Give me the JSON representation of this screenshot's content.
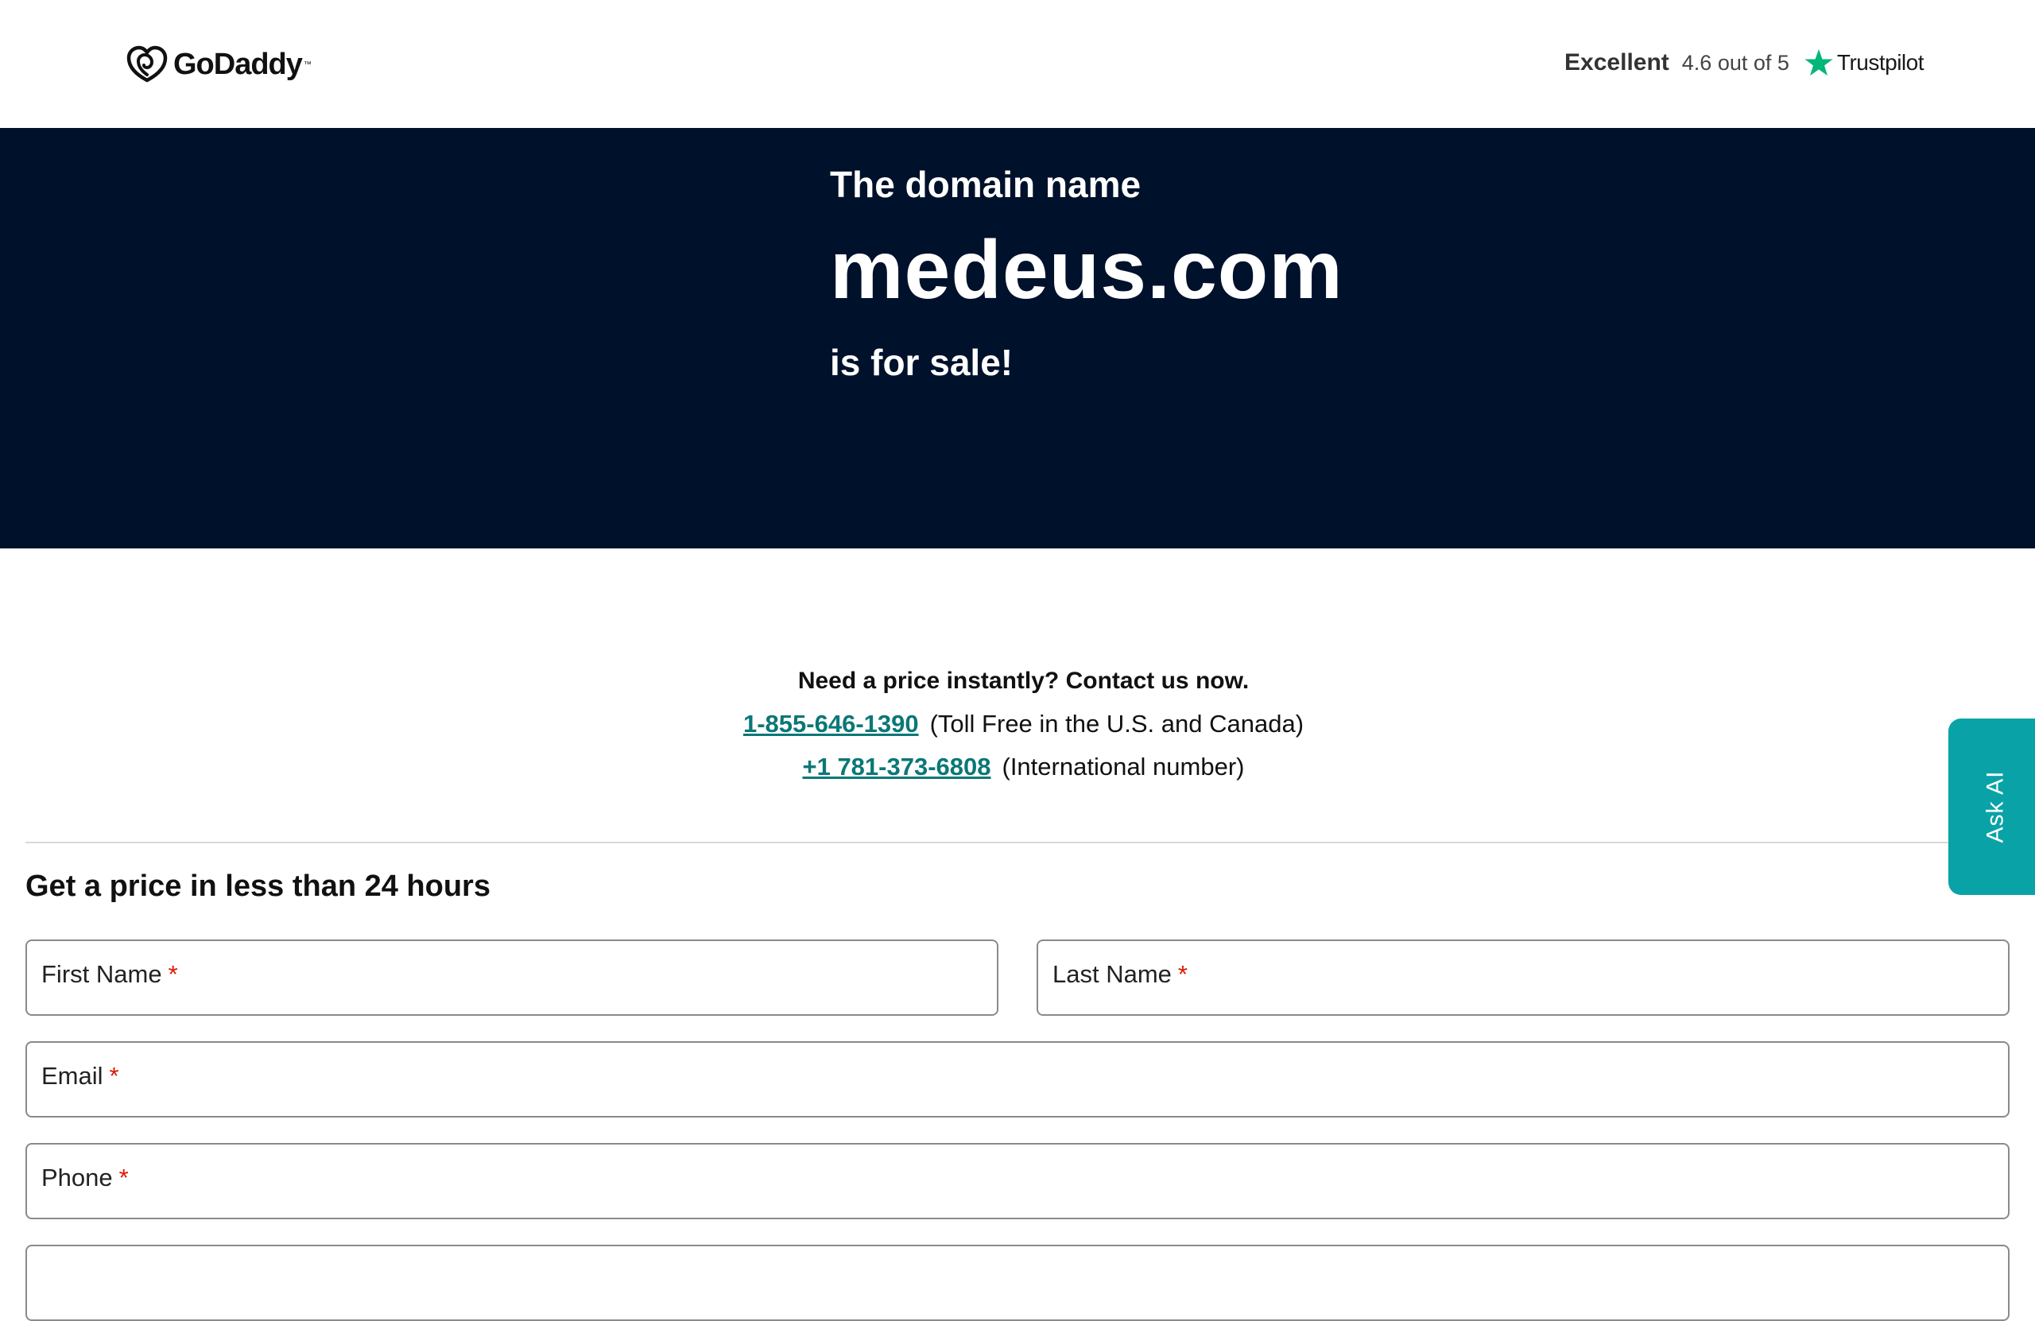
{
  "header": {
    "brand": "GoDaddy",
    "logo_icon": "godaddy-heart-logo-icon",
    "rating_word": "Excellent",
    "rating_score": "4.6 out of 5",
    "rating_icon": "trustpilot-star-icon",
    "rating_source": "Trustpilot",
    "star_color": "#00b67a"
  },
  "hero": {
    "lead": "The domain name",
    "domain": "medeus.com",
    "tail": "is for sale!",
    "background": "#00112c"
  },
  "contact": {
    "question": "Need a price instantly? Contact us now.",
    "phones": [
      {
        "number": "1-855-646-1390",
        "note": "(Toll Free in the U.S. and Canada)"
      },
      {
        "number": "+1 781-373-6808",
        "note": "(International number)"
      }
    ],
    "link_color": "#0b7777"
  },
  "form": {
    "title": "Get a price in less than 24 hours",
    "first_name_label": "First Name",
    "last_name_label": "Last Name",
    "email_label": "Email",
    "phone_label": "Phone",
    "required_marker": "*"
  },
  "ask_ai": {
    "label": "Ask AI",
    "color": "#09a3a7"
  }
}
